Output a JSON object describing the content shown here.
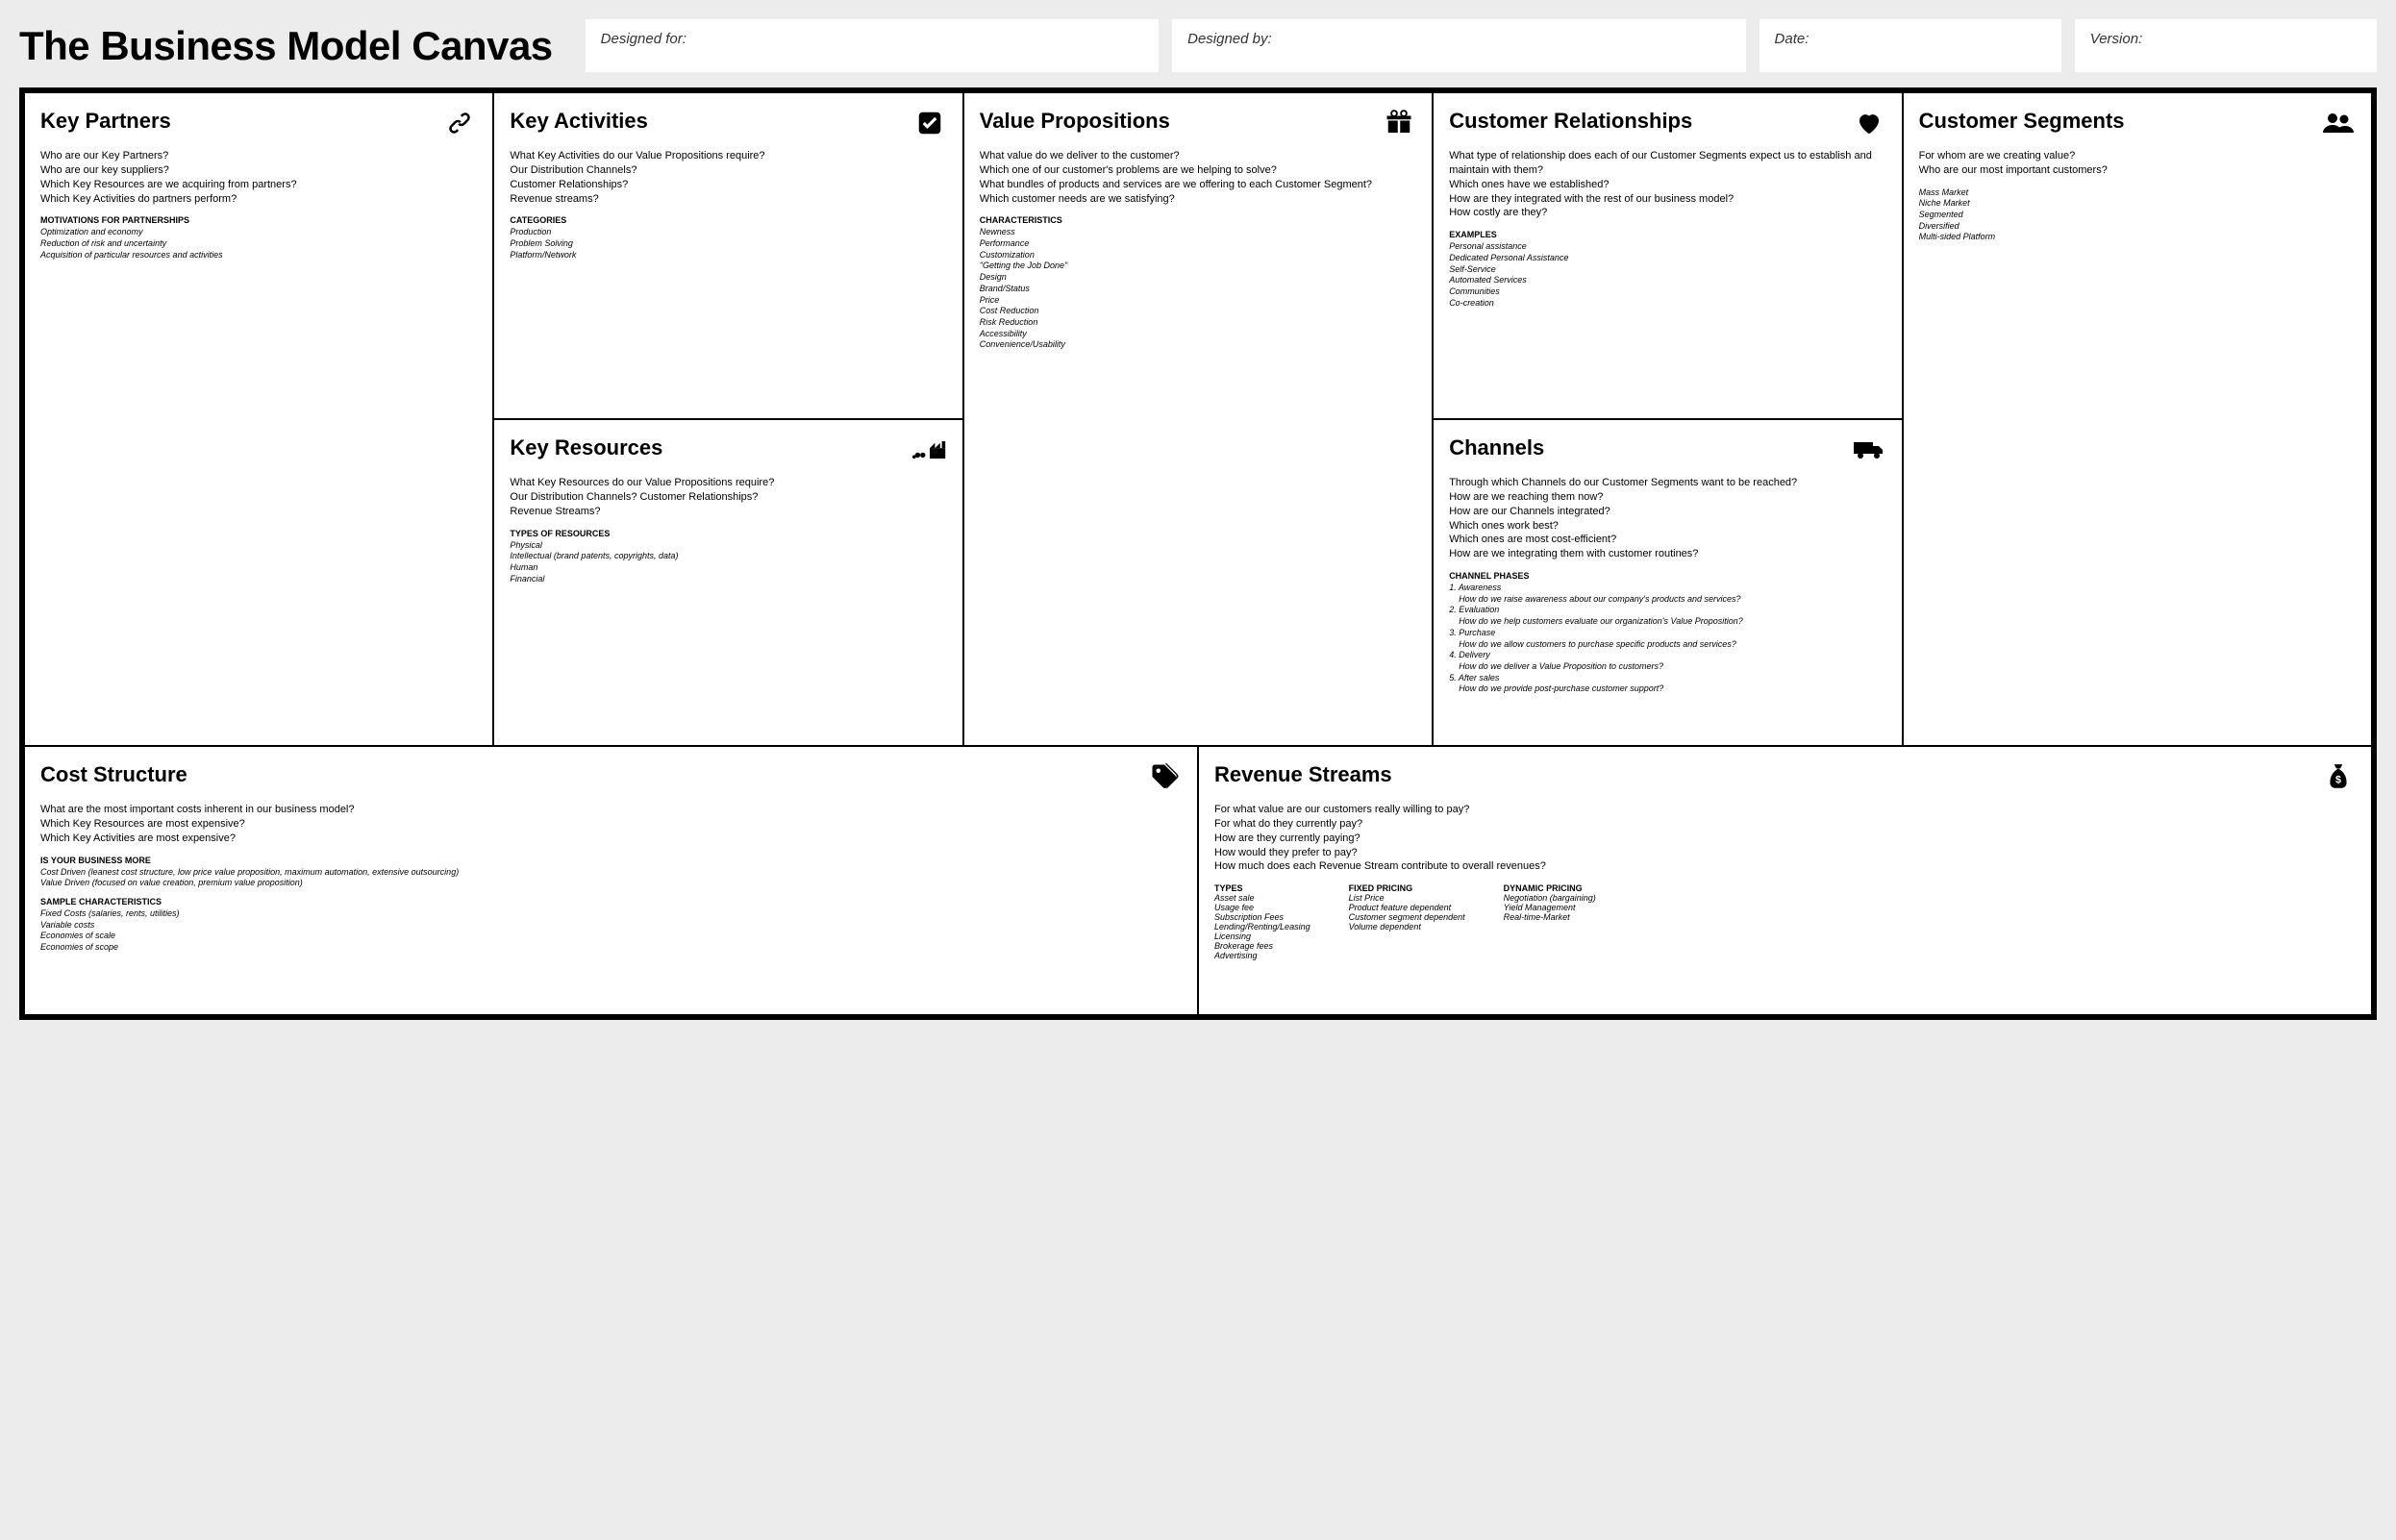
{
  "title": "The Business Model Canvas",
  "meta": {
    "designed_for": "Designed for:",
    "designed_by": "Designed by:",
    "date": "Date:",
    "version": "Version:"
  },
  "cells": {
    "key_partners": {
      "title": "Key Partners",
      "questions": [
        "Who are our Key Partners?",
        "Who are our key suppliers?",
        "Which Key Resources are we acquiring from partners?",
        "Which Key Activities do partners perform?"
      ],
      "subheading": "Motivations for partnerships",
      "items": [
        "Optimization and economy",
        "Reduction of risk and uncertainty",
        "Acquisition of particular resources and activities"
      ]
    },
    "key_activities": {
      "title": "Key Activities",
      "questions": [
        "What Key Activities do our Value Propositions require?",
        "Our Distribution Channels?",
        "Customer Relationships?",
        "Revenue streams?"
      ],
      "subheading": "Categories",
      "items": [
        "Production",
        "Problem Solving",
        "Platform/Network"
      ]
    },
    "key_resources": {
      "title": "Key Resources",
      "questions": [
        "What Key Resources do our Value Propositions require?",
        "Our Distribution Channels? Customer Relationships?",
        "Revenue Streams?"
      ],
      "subheading": "Types of resources",
      "items": [
        "Physical",
        "Intellectual (brand patents, copyrights, data)",
        "Human",
        "Financial"
      ]
    },
    "value_propositions": {
      "title": "Value Propositions",
      "questions": [
        "What value do we deliver to the customer?",
        "Which one of our customer's problems are we helping to solve?",
        "What bundles of products and services are we offering to each Customer Segment?",
        "Which customer needs are we satisfying?"
      ],
      "subheading": "Characteristics",
      "items": [
        "Newness",
        "Performance",
        "Customization",
        "\"Getting the Job Done\"",
        "Design",
        "Brand/Status",
        "Price",
        "Cost Reduction",
        "Risk Reduction",
        "Accessibility",
        "Convenience/Usability"
      ]
    },
    "customer_relationships": {
      "title": "Customer Relationships",
      "questions": [
        "What type of relationship does each of our Customer Segments expect us to establish and maintain with them?",
        "Which ones have we established?",
        "How are they integrated with the rest of our business model?",
        "How costly are they?"
      ],
      "subheading": "Examples",
      "items": [
        "Personal assistance",
        "Dedicated Personal Assistance",
        "Self-Service",
        "Automated Services",
        "Communities",
        "Co-creation"
      ]
    },
    "channels": {
      "title": "Channels",
      "questions": [
        "Through which Channels do our Customer Segments want to be reached?",
        "How are we reaching them now?",
        "How are our Channels integrated?",
        "Which ones work best?",
        "Which ones are most cost-efficient?",
        "How are we integrating them with customer routines?"
      ],
      "subheading": "Channel phases",
      "phases": [
        {
          "label": "1. Awareness",
          "q": "How do we raise awareness about our company's products and services?"
        },
        {
          "label": "2. Evaluation",
          "q": "How do we help customers evaluate our organization's Value Proposition?"
        },
        {
          "label": "3. Purchase",
          "q": "How do we allow customers to purchase specific products and services?"
        },
        {
          "label": "4. Delivery",
          "q": "How do we deliver a Value Proposition to customers?"
        },
        {
          "label": "5. After sales",
          "q": "How do we provide post-purchase customer support?"
        }
      ]
    },
    "customer_segments": {
      "title": "Customer Segments",
      "questions": [
        "For whom are we creating value?",
        "Who are our most important customers?"
      ],
      "items": [
        "Mass Market",
        "Niche Market",
        "Segmented",
        "Diversified",
        "Multi-sided Platform"
      ]
    },
    "cost_structure": {
      "title": "Cost Structure",
      "questions": [
        "What are the most important costs inherent in our business model?",
        "Which Key Resources are most expensive?",
        "Which Key Activities are most expensive?"
      ],
      "sub1_heading": "Is your business more",
      "sub1_items": [
        "Cost Driven (leanest cost structure, low price value proposition, maximum automation, extensive outsourcing)",
        "Value Driven (focused on value creation, premium value proposition)"
      ],
      "sub2_heading": "Sample characteristics",
      "sub2_items": [
        "Fixed Costs (salaries, rents, utilities)",
        "Variable costs",
        "Economies of scale",
        "Economies of scope"
      ]
    },
    "revenue_streams": {
      "title": "Revenue Streams",
      "questions": [
        "For what value are our customers really willing to pay?",
        "For what do they currently pay?",
        "How are they currently paying?",
        "How would they prefer to pay?",
        "How much does each Revenue Stream contribute to overall revenues?"
      ],
      "cols": [
        {
          "hdr": "Types",
          "items": [
            "Asset sale",
            "Usage fee",
            "Subscription Fees",
            "Lending/Renting/Leasing",
            "Licensing",
            "Brokerage fees",
            "Advertising"
          ]
        },
        {
          "hdr": "Fixed pricing",
          "items": [
            "List Price",
            "Product feature dependent",
            "Customer segment dependent",
            "Volume dependent"
          ]
        },
        {
          "hdr": "Dynamic pricing",
          "items": [
            "Negotiation (bargaining)",
            "Yield Management",
            "Real-time-Market"
          ]
        }
      ]
    }
  }
}
